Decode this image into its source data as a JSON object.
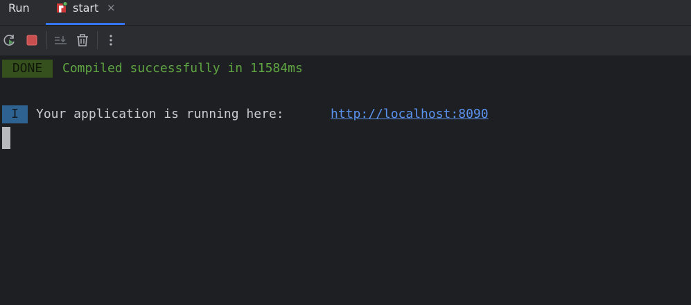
{
  "panel": {
    "title": "Run"
  },
  "tab": {
    "label": "start",
    "close_symbol": "×",
    "icon": "npm-run-icon",
    "status_color": "#5fb85c"
  },
  "toolbar": {
    "buttons": [
      {
        "icon": "rerun-icon"
      },
      {
        "icon": "stop-icon"
      },
      {
        "icon": "scroll-to-end-icon"
      },
      {
        "icon": "clear-all-icon"
      },
      {
        "icon": "more-options-icon"
      }
    ]
  },
  "console": {
    "lines": [
      {
        "badge": "DONE",
        "badge_color": "#35501c",
        "text": "Compiled successfully in 11584ms",
        "text_color": "#5fa642"
      },
      {
        "badge": "I",
        "badge_color": "#2e6391",
        "text": "Your application is running here: ",
        "link": "http://localhost:8090"
      }
    ]
  },
  "colors": {
    "accent": "#3574f0",
    "background": "#1e1f22",
    "toolbar_bg": "#2b2d30"
  }
}
